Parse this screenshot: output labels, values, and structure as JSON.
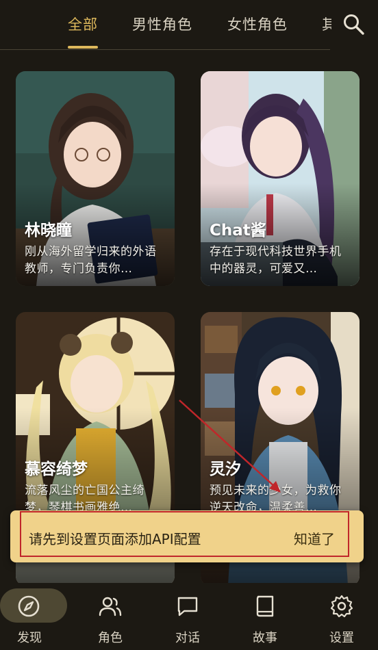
{
  "tabs": {
    "all": "全部",
    "male": "男性角色",
    "female": "女性角色",
    "more": "其"
  },
  "icons": {
    "search": "search-icon",
    "discover": "compass-icon",
    "roles": "users-icon",
    "chat": "message-icon",
    "story": "book-icon",
    "settings": "gear-icon"
  },
  "cards": [
    {
      "name": "林晓瞳",
      "desc": "刚从海外留学归来的外语教师，专门负责你…"
    },
    {
      "name": "Chat酱",
      "desc": "存在于现代科技世界手机中的器灵，可爱又…"
    },
    {
      "name": "慕容绮梦",
      "desc": "流落风尘的亡国公主绮梦，琴棋书画雅绝…"
    },
    {
      "name": "灵汐",
      "desc": "预见未来的少女，为救你逆天改命，温柔善…"
    }
  ],
  "toast": {
    "message": "请先到设置页面添加API配置",
    "action": "知道了"
  },
  "nav": {
    "discover": "发现",
    "roles": "角色",
    "chat": "对话",
    "story": "故事",
    "settings": "设置"
  },
  "colors": {
    "accent": "#ddb85c",
    "background": "#1c1913",
    "toast": "#f0d28a",
    "highlight": "#c0262a"
  }
}
